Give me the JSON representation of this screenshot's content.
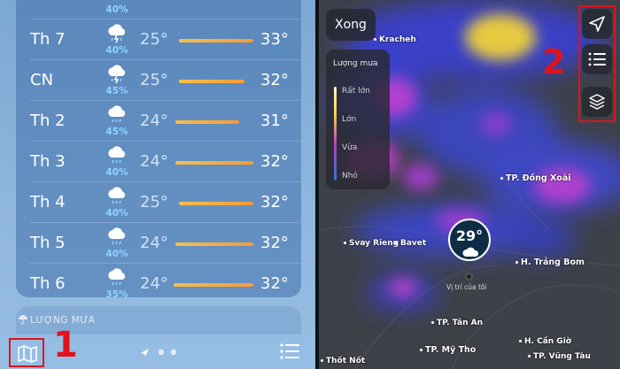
{
  "forecast": {
    "rows": [
      {
        "day": "",
        "pct": "40%",
        "low": "",
        "high": ""
      },
      {
        "day": "Th 7",
        "pct": "40%",
        "low": "25°",
        "high": "33°"
      },
      {
        "day": "CN",
        "pct": "45%",
        "low": "25°",
        "high": "32°"
      },
      {
        "day": "Th 2",
        "pct": "45%",
        "low": "24°",
        "high": "31°"
      },
      {
        "day": "Th 3",
        "pct": "40%",
        "low": "24°",
        "high": "32°"
      },
      {
        "day": "Th 4",
        "pct": "40%",
        "low": "25°",
        "high": "32°"
      },
      {
        "day": "Th 5",
        "pct": "40%",
        "low": "24°",
        "high": "32°"
      },
      {
        "day": "Th 6",
        "pct": "35%",
        "low": "24°",
        "high": "32°"
      }
    ],
    "icon": "cloud-rain-lightning-icon"
  },
  "rain_section": {
    "label": "LƯỢNG MƯA",
    "icon": "umbrella-icon"
  },
  "bottom_bar": {
    "map_icon": "map-icon",
    "annotation_1": "1",
    "list_icon": "list-icon",
    "page_dots": "location-arrow-and-dots"
  },
  "map": {
    "done_label": "Xong",
    "legend": {
      "title": "Lượng mưa",
      "items": [
        "Rất lớn",
        "Lớn",
        "Vừa",
        "Nhỏ"
      ]
    },
    "annotation_2": "2",
    "controls": [
      "navigation-arrow-icon",
      "list-icon",
      "layers-icon"
    ],
    "temp_pin": {
      "value": "29°",
      "label": "Vị trí của tôi"
    },
    "places": [
      {
        "name": "Kracheh"
      },
      {
        "name": "TP. Đồng Xoài"
      },
      {
        "name": "Svay Rieng"
      },
      {
        "name": "Bavet"
      },
      {
        "name": "H. Trảng Bom"
      },
      {
        "name": "TP. Tân An"
      },
      {
        "name": "TP. Mỹ Tho"
      },
      {
        "name": "H. Cần Giờ"
      },
      {
        "name": "TP. Vũng Tàu"
      },
      {
        "name": "Thốt Nốt"
      }
    ]
  },
  "colors": {
    "annotation_red": "#e0131b",
    "temp_bar": "#f7a83a",
    "pct_blue": "#8fd4ff"
  }
}
